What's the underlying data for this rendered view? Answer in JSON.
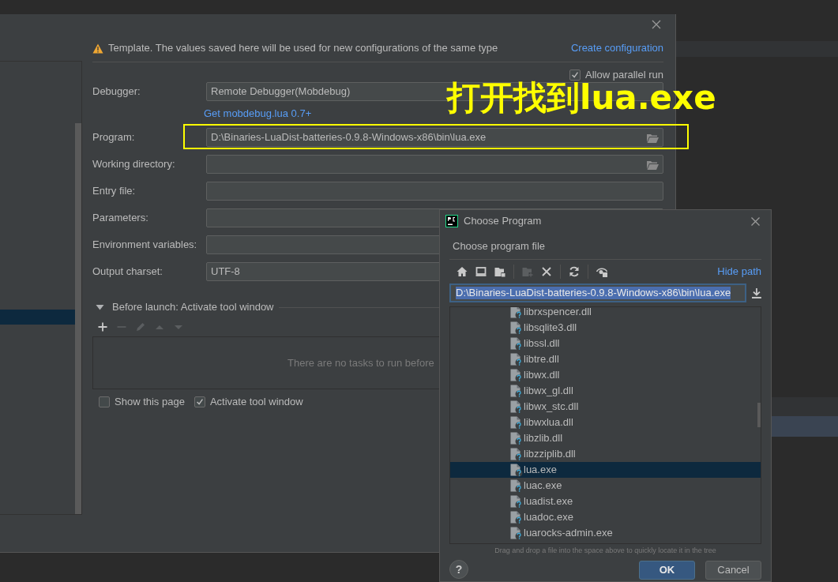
{
  "run_config_dialog": {
    "template_notice": "Template. The values saved here will be used for new configurations of the same type",
    "create_link": "Create configuration",
    "allow_parallel_run": {
      "label": "Allow parallel run",
      "checked": true
    },
    "fields": [
      {
        "label": "Debugger:",
        "kind": "combo",
        "value": "Remote Debugger(Mobdebug)",
        "highlighted": false
      },
      {
        "kind": "link",
        "value": "Get mobdebug.lua 0.7+"
      },
      {
        "label": "Program:",
        "kind": "browse",
        "value": "D:\\Binaries-LuaDist-batteries-0.9.8-Windows-x86\\bin\\lua.exe",
        "highlighted": true
      },
      {
        "label": "Working directory:",
        "kind": "browse",
        "highlighted": false
      },
      {
        "label": "Entry file:",
        "kind": "text",
        "highlighted": false
      },
      {
        "label": "Parameters:",
        "kind": "text",
        "highlighted": false
      },
      {
        "label": "Environment variables:",
        "kind": "text",
        "highlighted": false
      },
      {
        "label": "Output charset:",
        "kind": "combo",
        "value": "UTF-8",
        "highlighted": false
      }
    ],
    "before_launch": {
      "label": "Before launch: Activate tool window",
      "expanded": true,
      "toolbar": [
        {
          "kind": "add",
          "disabled": false
        },
        {
          "kind": "remove",
          "disabled": true
        },
        {
          "kind": "edit",
          "disabled": true
        },
        {
          "kind": "up",
          "disabled": true
        },
        {
          "kind": "down",
          "disabled": true
        }
      ],
      "empty_text": "There are no tasks to run before"
    },
    "options": [
      {
        "label": "Show this page",
        "checked": false
      },
      {
        "label": "Activate tool window",
        "checked": true
      }
    ]
  },
  "annotation": {
    "text": "打开找到lua.exe"
  },
  "choose_program_dialog": {
    "title": "Choose Program",
    "subtitle": "Choose program file",
    "toolbar": [
      {
        "kind": "home",
        "disabled": false
      },
      {
        "kind": "desktop",
        "disabled": false
      },
      {
        "kind": "project",
        "disabled": false
      },
      {
        "kind": "separator"
      },
      {
        "kind": "new-folder",
        "disabled": true
      },
      {
        "kind": "delete",
        "disabled": false
      },
      {
        "kind": "separator"
      },
      {
        "kind": "refresh",
        "disabled": false
      },
      {
        "kind": "separator"
      },
      {
        "kind": "show-hidden",
        "disabled": false
      }
    ],
    "hide_path_link": "Hide path",
    "path": {
      "value": "D:\\Binaries-LuaDist-batteries-0.9.8-Windows-x86\\bin\\lua.exe",
      "selected": true
    },
    "tree": [
      {
        "name": "librxspencer.dll",
        "selected": false
      },
      {
        "name": "libsqlite3.dll",
        "selected": false
      },
      {
        "name": "libssl.dll",
        "selected": false
      },
      {
        "name": "libtre.dll",
        "selected": false
      },
      {
        "name": "libwx.dll",
        "selected": false
      },
      {
        "name": "libwx_gl.dll",
        "selected": false
      },
      {
        "name": "libwx_stc.dll",
        "selected": false
      },
      {
        "name": "libwxlua.dll",
        "selected": false
      },
      {
        "name": "libzlib.dll",
        "selected": false
      },
      {
        "name": "libzziplib.dll",
        "selected": false
      },
      {
        "name": "lua.exe",
        "selected": true
      },
      {
        "name": "luac.exe",
        "selected": false
      },
      {
        "name": "luadist.exe",
        "selected": false
      },
      {
        "name": "luadoc.exe",
        "selected": false
      },
      {
        "name": "luarocks-admin.exe",
        "selected": false
      }
    ],
    "hint": "Drag and drop a file into the space above to quickly locate it in the tree",
    "buttons": [
      {
        "kind": "help",
        "label": "?"
      },
      {
        "kind": "default",
        "label": "OK"
      },
      {
        "kind": "normal",
        "label": "Cancel"
      }
    ]
  }
}
